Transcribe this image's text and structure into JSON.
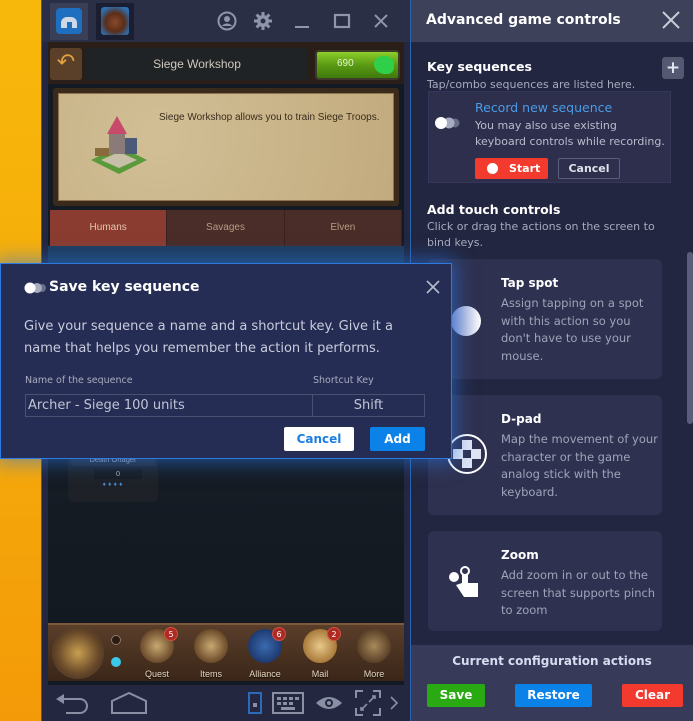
{
  "emulator": {
    "titlebar": {
      "tabs": [
        {
          "name": "home",
          "icon": "home-icon"
        },
        {
          "name": "game",
          "icon": "game-avatar-icon"
        }
      ],
      "icons": [
        "account-icon",
        "gear-icon",
        "minimize-icon",
        "maximize-icon",
        "close-icon"
      ]
    },
    "game": {
      "header_title": "Siege Workshop",
      "gems": "690",
      "description": "Siege Workshop allows you to train Siege Troops.",
      "tabs": [
        {
          "label": "Humans",
          "active": true
        },
        {
          "label": "Savages",
          "active": false
        },
        {
          "label": "Elven",
          "active": false
        }
      ],
      "unit": {
        "name": "Death Onager",
        "count": "0",
        "stars": "♦♦♦♦"
      },
      "bottom_bar": [
        {
          "label": "Quest",
          "badge": "5"
        },
        {
          "label": "Items",
          "badge": null
        },
        {
          "label": "Alliance",
          "badge": "6"
        },
        {
          "label": "Mail",
          "badge": "2"
        },
        {
          "label": "More",
          "badge": null
        }
      ]
    },
    "navbar_icons": [
      "back-icon",
      "home-icon",
      "phone-icon",
      "keyboard-icon",
      "eye-icon",
      "fullscreen-icon",
      "chevron-right-icon"
    ]
  },
  "panel": {
    "title": "Advanced game controls",
    "key_sequences": {
      "title": "Key sequences",
      "subtitle": "Tap/combo sequences are listed here.",
      "record_title": "Record new sequence",
      "record_text": "You may also use existing keyboard controls while recording.",
      "start_label": "Start",
      "cancel_label": "Cancel"
    },
    "touch_controls": {
      "title": "Add touch controls",
      "subtitle": "Click or drag the actions on the screen to bind keys.",
      "cards": [
        {
          "title": "Tap spot",
          "text": "Assign tapping on a spot with this action so you don't have to use your mouse.",
          "icon": "tap-spot-icon"
        },
        {
          "title": "D-pad",
          "text": "Map the movement of your character or the game analog stick with the keyboard.",
          "icon": "dpad-icon"
        },
        {
          "title": "Zoom",
          "text": "Add zoom in or out to the screen that supports pinch to zoom",
          "icon": "pinch-zoom-icon"
        }
      ]
    },
    "footer": {
      "title": "Current configuration actions",
      "save_label": "Save",
      "restore_label": "Restore",
      "clear_label": "Clear"
    },
    "colors": {
      "save": "#2aaa12",
      "restore": "#0a82e8",
      "clear": "#f33a2e",
      "link": "#4a9ce8"
    }
  },
  "modal": {
    "title": "Save key sequence",
    "text": "Give your sequence a name and a shortcut key. Give it a name that helps you remember the action it performs.",
    "name_label": "Name of the sequence",
    "key_label": "Shortcut Key",
    "name_value": "Archer - Siege 100 units",
    "key_value": "Shift",
    "cancel_label": "Cancel",
    "add_label": "Add"
  }
}
